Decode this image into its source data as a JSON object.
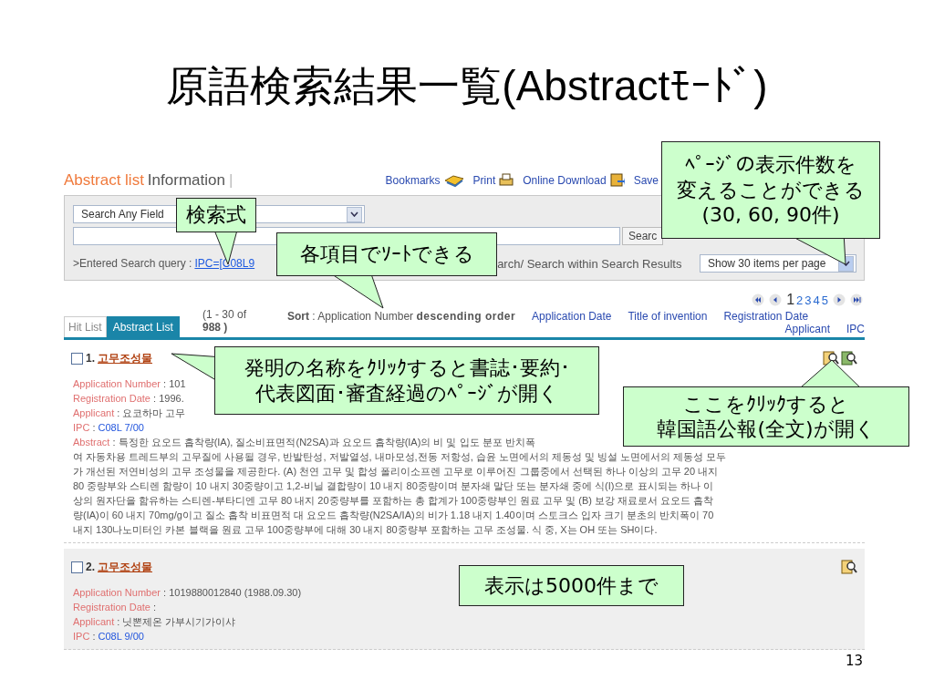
{
  "slide_title": "原語検索結果一覧(Abstractﾓｰﾄﾞ)",
  "header": {
    "title_main": "Abstract list",
    "title_sub": "Information",
    "separator": "|",
    "links": [
      {
        "label": "Bookmarks"
      },
      {
        "label": "Print"
      },
      {
        "label": "Online Download"
      },
      {
        "label": "Save"
      }
    ]
  },
  "search": {
    "field_select": "Search Any Field",
    "search_button": "Searc",
    "query_label": ">Entered Search query : ",
    "query_link": "IPC=[C08L9",
    "query_rest": "arch/ Search within Search Results",
    "per_page": "Show 30 items per page"
  },
  "results": {
    "range": "(1 - 30 of",
    "total": "988 )",
    "tabs": [
      {
        "label": "Hit List",
        "selected": false
      },
      {
        "label": "Abstract List",
        "selected": true
      }
    ],
    "sort_label": "Sort",
    "sort_sep": " : ",
    "sort_current": "Application Number",
    "sort_order": "descending order",
    "sort_options": [
      "Application Date",
      "Title of invention",
      "Registration Date"
    ],
    "sort_options_2": [
      "Applicant",
      "IPC"
    ],
    "pagination": {
      "current": "1",
      "pages": [
        "2",
        "3",
        "4",
        "5"
      ]
    }
  },
  "items": [
    {
      "number": "1.",
      "title": "고무조성물",
      "checked": false,
      "shaded": false,
      "icons": [
        {
          "kind": "document"
        },
        {
          "kind": "image"
        }
      ],
      "fields": [
        {
          "label": "Application Number",
          "value": " : 101",
          "kind": "text"
        },
        {
          "label": "Registration Date",
          "value": " : 1996.",
          "kind": "text"
        },
        {
          "label": "Applicant",
          "value": " : 요코하마 고무",
          "kind": "text"
        },
        {
          "label": "IPC",
          "value": " : ",
          "code": "C08L 7/00",
          "kind": "code"
        }
      ],
      "abstract": {
        "label": "Abstract",
        "sep": " : ",
        "lines": [
          "특정한 요오드 흡착량(IA), 질소비표면적(N2SA)과 요오드 흡착량(IA)의 비 및 입도 분포 반치폭",
          "여 자동차용 트레드부의 고무질에 사용될 경우, 반발탄성, 저발열성, 내마모성,전동 저항성, 습윤 노면에서의 제동성 및 빙설 노면에서의 제동성 모두",
          "가 개선된 저연비성의 고무 조성물을 제공한다. (A) 천연 고무 및 합성 폴리이소프렌 고무로 이루어진 그룹중에서 선택된 하나 이상의 고무 20 내지",
          "80 중량부와 스티렌 함량이 10 내지 30중량이고 1,2-비닐 결합량이 10 내지 80중량이며 분자쇄 말단 또는 분자쇄 중에 식(I)으로 표시되는 하나 이",
          "상의 원자단을 함유하는 스티렌-부타디엔 고무 80 내지 20중량부를 포함하는 총 합계가 100중량부인 원료 고무 및 (B) 보강 재료로서 요오드 흡착",
          "량(IA)이 60 내지 70mg/g이고 질소 흡착 비표면적 대 요오드 흡착량(N2SA/IA)의 비가 1.18 내지 1.40이며 스토크스 입자 크기 분초의 반치폭이 70",
          "내지 130나노미터인 카본 블랙을 원료 고무 100중량부에 대해 30 내지 80중량부 포함하는 고무 조성물. 식 중, X는 OH 또는 SH이다."
        ]
      }
    },
    {
      "number": "2.",
      "title": "고무조성물",
      "checked": false,
      "shaded": true,
      "icons": [
        {
          "kind": "document"
        }
      ],
      "fields": [
        {
          "label": "Application Number",
          "value": " : 1019880012840  (1988.09.30)",
          "kind": "text"
        },
        {
          "label": "Registration Date",
          "value": " :",
          "kind": "text"
        },
        {
          "label": "Applicant",
          "value": " : 닛뽄제온 가부시기가이샤",
          "kind": "text"
        },
        {
          "label": "IPC",
          "value": " : ",
          "code": "C08L 9/00",
          "kind": "code"
        }
      ]
    }
  ],
  "callouts": [
    {
      "kind": "pointer",
      "lines": [
        "検索式"
      ]
    },
    {
      "kind": "pointer",
      "lines": [
        "各項目でｿｰﾄできる"
      ]
    },
    {
      "kind": "pointer",
      "lines": [
        "ﾍﾟｰｼﾞの表示件数を",
        "変えることができる",
        "(30, 60, 90件)"
      ]
    },
    {
      "kind": "pointer",
      "lines": [
        "発明の名称をｸﾘｯｸすると書誌･要約･",
        "代表図面･審査経過のﾍﾟｰｼﾞが開く"
      ]
    },
    {
      "kind": "pointer",
      "lines": [
        "ここをｸﾘｯｸすると",
        "韓国語公報(全文)が開く"
      ]
    },
    {
      "kind": "plain",
      "lines": [
        "表示は5000件まで"
      ]
    }
  ],
  "page_number": "13"
}
